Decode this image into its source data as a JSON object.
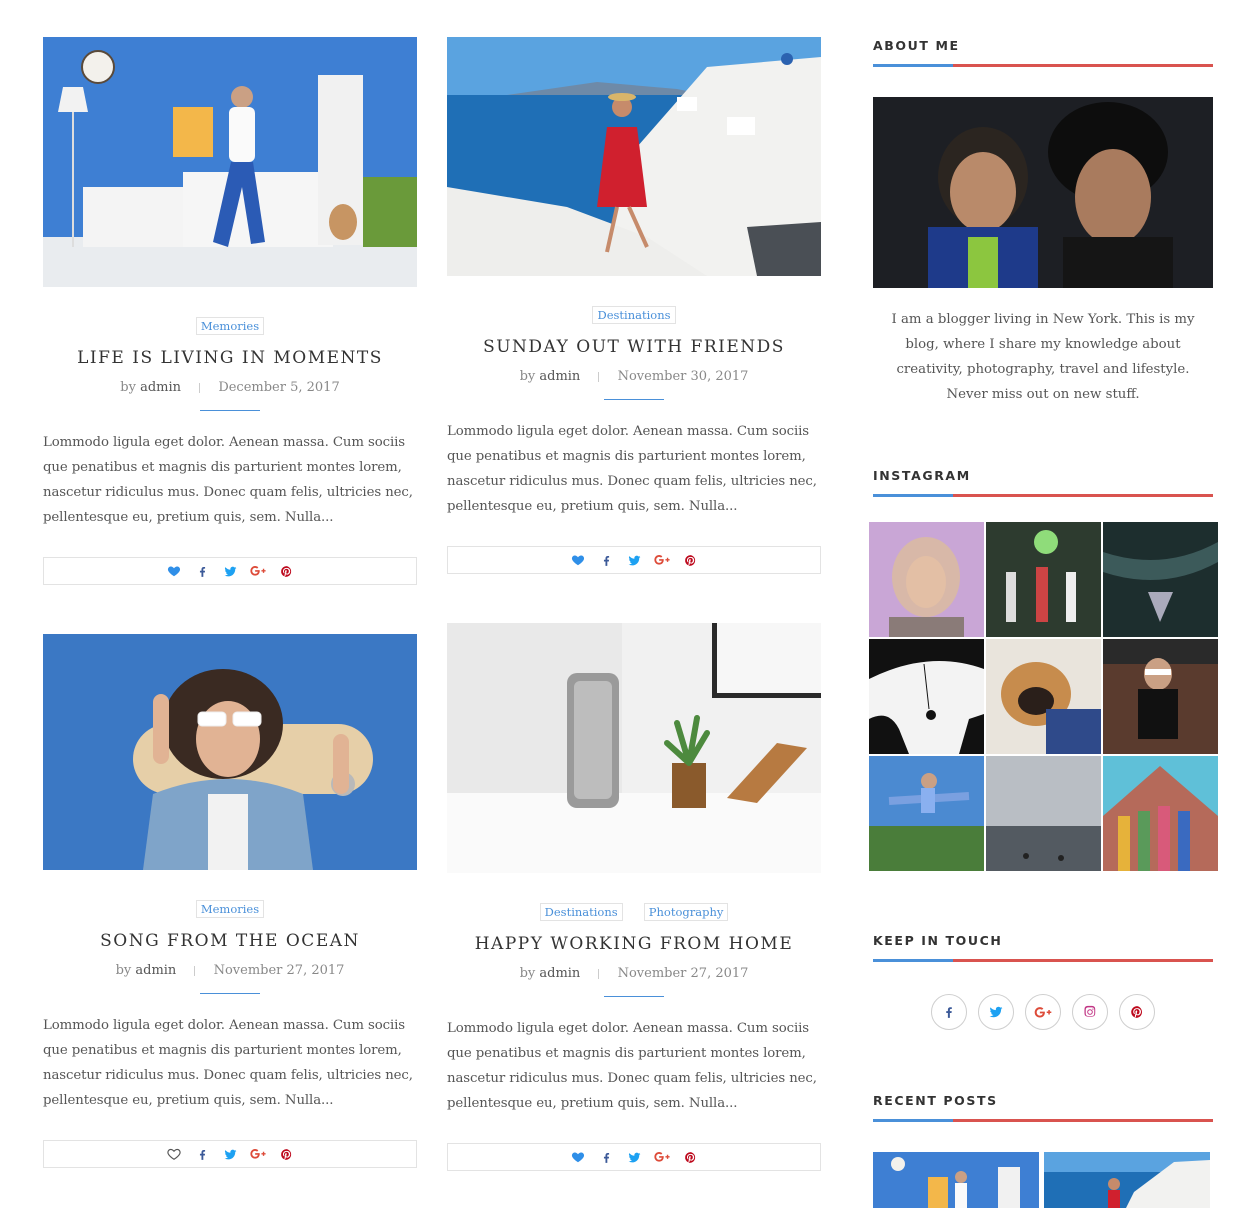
{
  "colors": {
    "accent_blue": "#4a90d9",
    "accent_red": "#d9534f",
    "heart_blue": "#2f8fe8",
    "facebook": "#3b5998",
    "twitter": "#1da1f2",
    "google": "#dd4b39",
    "pinterest": "#bd081c",
    "instagram": "#c13584"
  },
  "posts": [
    {
      "categories": [
        "Memories"
      ],
      "title": "LIFE IS LIVING IN MOMENTS",
      "by": "by",
      "author": "admin",
      "date": "December 5, 2017",
      "excerpt": "Lommodo ligula eget dolor. Aenean massa. Cum sociis que penatibus et magnis dis parturient montes lorem, nascetur ridiculus mus. Donec quam felis, ultricies nec, pellentesque eu, pretium quis, sem. Nulla...",
      "liked": true,
      "image": "woman-dancing-blue-room"
    },
    {
      "categories": [
        "Destinations"
      ],
      "title": "SUNDAY OUT WITH FRIENDS",
      "by": "by",
      "author": "admin",
      "date": "November 30, 2017",
      "excerpt": "Lommodo ligula eget dolor. Aenean massa. Cum sociis que penatibus et magnis dis parturient montes lorem, nascetur ridiculus mus. Donec quam felis, ultricies nec, pellentesque eu, pretium quis, sem. Nulla...",
      "liked": true,
      "image": "woman-red-dress-santorini"
    },
    {
      "categories": [
        "Memories"
      ],
      "title": "SONG FROM THE OCEAN",
      "by": "by",
      "author": "admin",
      "date": "November 27, 2017",
      "excerpt": "Lommodo ligula eget dolor. Aenean massa. Cum sociis que penatibus et magnis dis parturient montes lorem, nascetur ridiculus mus. Donec quam felis, ultricies nec, pellentesque eu, pretium quis, sem. Nulla...",
      "liked": false,
      "image": "woman-sunglasses-skateboard"
    },
    {
      "categories": [
        "Destinations",
        "Photography"
      ],
      "title": "HAPPY WORKING FROM HOME",
      "by": "by",
      "author": "admin",
      "date": "November 27, 2017",
      "excerpt": "Lommodo ligula eget dolor. Aenean massa. Cum sociis que penatibus et magnis dis parturient montes lorem, nascetur ridiculus mus. Donec quam felis, ultricies nec, pellentesque eu, pretium quis, sem. Nulla...",
      "liked": true,
      "image": "speaker-and-plant-desk"
    }
  ],
  "sidebar": {
    "about": {
      "title": "ABOUT ME",
      "text": "I am a blogger living in New York. This is my blog, where I share my knowledge about creativity, photography, travel and lifestyle. Never miss out on new stuff.",
      "image": "selfie-two-people"
    },
    "instagram": {
      "title": "INSTAGRAM",
      "tiles": [
        "hijab-portrait",
        "night-dancers",
        "dark-landscape",
        "tree-swing",
        "pug-in-hoodie",
        "girl-sunglasses-stairs",
        "jumping-person",
        "foggy-sea",
        "colorful-barn"
      ]
    },
    "touch": {
      "title": "KEEP IN TOUCH",
      "icons": [
        "facebook-icon",
        "twitter-icon",
        "google-plus-icon",
        "instagram-icon",
        "pinterest-icon"
      ]
    },
    "recent": {
      "title": "RECENT POSTS",
      "thumbs": [
        "woman-dancing-blue-room",
        "woman-red-dress-santorini"
      ]
    }
  }
}
